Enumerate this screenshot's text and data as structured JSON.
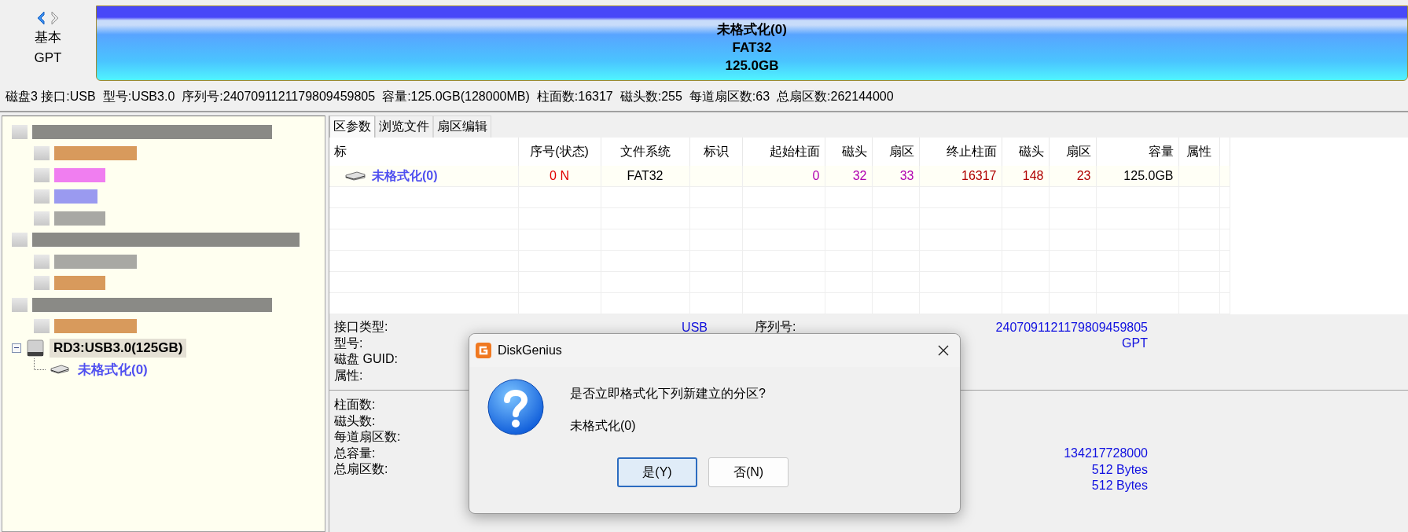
{
  "nav": {
    "mode": "基本",
    "style": "GPT"
  },
  "disk_bar": {
    "partition": "未格式化(0)",
    "filesystem": "FAT32",
    "size": "125.0GB"
  },
  "disk_info": [
    "磁盘3 接口:USB",
    "型号:USB3.0",
    "序列号:2407091121179809459805",
    "容量:125.0GB(128000MB)",
    "柱面数:16317",
    "磁头数:255",
    "每道扇区数:63",
    "总扇区数:262144000"
  ],
  "tree": [
    {
      "kind": "redacted",
      "color": "#8a8a86",
      "children": [
        {
          "kind": "redacted",
          "color": "#d89a5c"
        },
        {
          "kind": "redacted",
          "color": "#f07ef0"
        },
        {
          "kind": "redacted",
          "color": "#9a9af0"
        },
        {
          "kind": "redacted",
          "color": "#a8a8a4"
        }
      ]
    },
    {
      "kind": "redacted",
      "color": "#8a8a86",
      "children": [
        {
          "kind": "redacted",
          "color": "#a8a8a4"
        },
        {
          "kind": "redacted",
          "color": "#d89a5c"
        }
      ]
    },
    {
      "kind": "redacted",
      "color": "#8a8a86",
      "children": [
        {
          "kind": "redacted",
          "color": "#d89a5c"
        }
      ]
    },
    {
      "kind": "disk",
      "label": "RD3:USB3.0(125GB)",
      "expanded": true,
      "selected": true,
      "children": [
        {
          "kind": "partition",
          "label": "未格式化(0)",
          "selected": false
        }
      ]
    }
  ],
  "tabs": [
    {
      "label": "区参数",
      "selected": true
    },
    {
      "label": "浏览文件",
      "selected": false
    },
    {
      "label": "扇区编辑",
      "selected": false
    }
  ],
  "table": {
    "columns": [
      "标",
      "序号(状态)",
      "文件系统",
      "标识",
      "起始柱面",
      "磁头",
      "扇区",
      "终止柱面",
      "磁头",
      "扇区",
      "容量",
      "属性"
    ],
    "rows": [
      {
        "cells": [
          {
            "text": "未格式化(0)",
            "kind": "name"
          },
          {
            "text": "0 N",
            "kind": "status"
          },
          {
            "text": "FAT32",
            "kind": "plain"
          },
          {
            "kind": "blank"
          },
          {
            "text": "0",
            "kind": "start"
          },
          {
            "text": "32",
            "kind": "start"
          },
          {
            "text": "33",
            "kind": "start"
          },
          {
            "text": "16317",
            "kind": "end"
          },
          {
            "text": "148",
            "kind": "end"
          },
          {
            "text": "23",
            "kind": "end"
          },
          {
            "text": "125.0GB",
            "kind": "plain"
          }
        ]
      }
    ]
  },
  "info": [
    {
      "rows": [
        {
          "label": "接口类型:",
          "value": "USB",
          "label_2": "序列号:",
          "value_2": "2407091121179809459805"
        },
        {
          "label": "型号:",
          "value_2": "GPT"
        },
        {
          "label": "磁盘 GUID:"
        },
        {
          "label": "属性:"
        }
      ]
    },
    {
      "rows": [
        {
          "label": "柱面数:"
        },
        {
          "label": "磁头数:"
        },
        {
          "label": "每道扇区数:"
        },
        {
          "label": "总容量:",
          "value_2": "134217728000"
        },
        {
          "label": "总扇区数:",
          "value_2": "512 Bytes"
        },
        {
          "value_2": "512 Bytes"
        }
      ]
    }
  ],
  "dialog": {
    "title": "DiskGenius",
    "message": "是否立即格式化下列新建立的分区?",
    "item": "未格式化(0)",
    "buttons": [
      {
        "label": "是(Y)",
        "default": true
      },
      {
        "label": "否(N)",
        "default": false
      }
    ]
  }
}
